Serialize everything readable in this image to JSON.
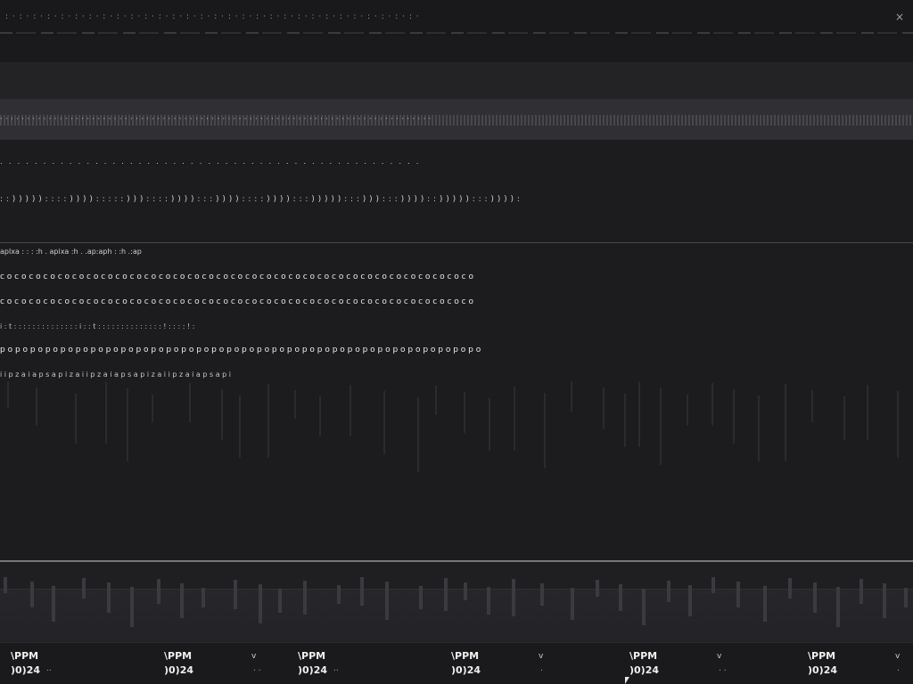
{
  "titlebar": {
    "title": ": · : · : · : · : · : · : · : · : · : · : · : · : · : · : · : · : · : · : · : · : · : · : · : · : · : · : · : · : · : ·",
    "close_icon": "×"
  },
  "tabstrip": {
    "text": "· · · · · · · · · · · · · · · · · · · · · · · · · · · · · · · · · · · · · · · · · · · · · · · · · · · · · · · · · · · · · · · · · · · · · · · · · · · · · · · ·"
  },
  "nav": {
    "row_a": ". .   .  .  .  .  .  .    .    . . .  . .    .  .  . .     .     .  .  . .    .  .  .  .  .  .   .  .  .  .   .  .  .  .   . . . .   .  .  .  .   .  .  .  .",
    "row_b": ": : ) ) ) ) ) :  : :  : ) ) ) ) :  : : :  : ) ) ) : : : : ) ) ) ) : : : ) ) ) ) : : : : ) ) ) ) : : : ) ) ) ) ) : : : ) ) ) : : : ) ) ) ) : : ) ) ) ) ) : : : ) ) ) ) :"
  },
  "table": {
    "header": "aplxa   : : :       :h   .  apixa   :h   .      .ap:aph      :     :h         .:ap",
    "rows": [
      "c o c o c o c o c o c o c o c o c o c o c o c o c o c o c o c o c o c o c o c o c o c o c o c o c o c o c o c o c o c o c o c o c o",
      "c o c o c o c o c o c o c o c o c o c o c o c o c o c o c o c o c o c o c o c o c o c o c o c o c o c o c o c o c o c o c o c o c o",
      "i  : t  : : :  :   : :  : :   : :    : :  : :   i  :  : t  : : :  :   : :  : :   : :   : :  : :  !  : :   : :   !  :",
      "p o p o p o p o p o p o p o p o p o p o p o p o p o p o p o p o p o p o p o p o p o p o p o p o p o p o p o p o p o p o p o p o",
      "i  i p z a  i  a p  s  a  p  i  z  a  i  i  p  z  a  i  a  p  s  a  p  i  z  a  i  i  p  z  a  i  a  p  s  a  p  i"
    ]
  },
  "statusbar": {
    "cells": [
      {
        "time": "\\PPM",
        "date": ")0)24",
        "v": "",
        "dot": ".."
      },
      {
        "time": "\\PPM",
        "date": ")0)24",
        "v": "v",
        "dot": ". ."
      },
      {
        "time": "\\PPM",
        "date": ")0)24",
        "v": "",
        "dot": ".."
      },
      {
        "time": "\\PPM",
        "date": ")0)24",
        "v": "v",
        "dot": "."
      },
      {
        "time": "\\PPM",
        "date": ")0)24",
        "v": "v",
        "dot": ". ."
      },
      {
        "time": "\\PPM",
        "date": ")0)24",
        "v": "v",
        "dot": "."
      }
    ]
  }
}
